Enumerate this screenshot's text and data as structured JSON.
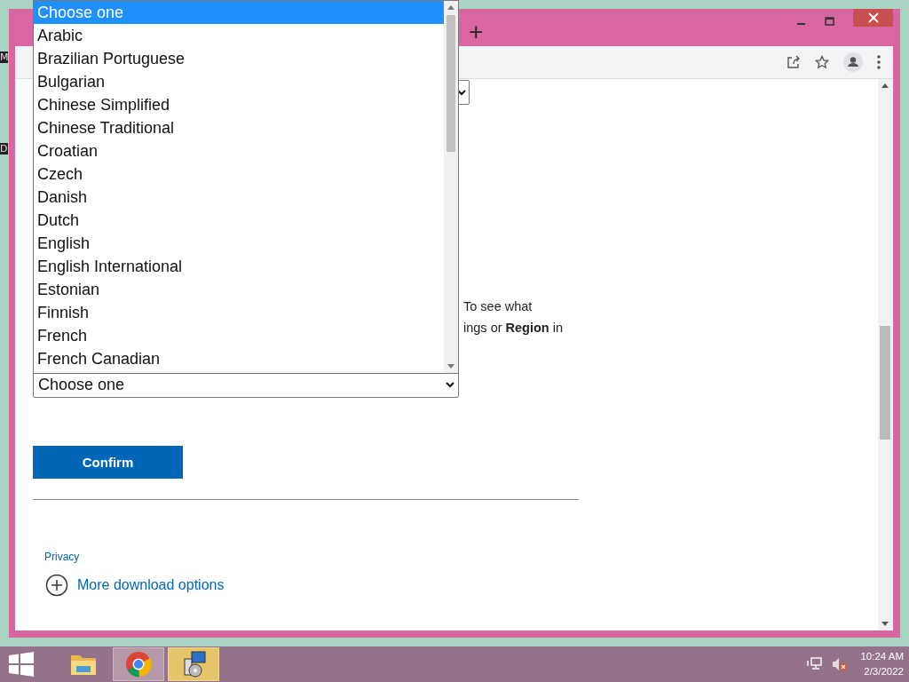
{
  "desktop": {
    "icon_labels": [
      "M",
      "D"
    ]
  },
  "browser": {
    "new_tab_label": "+"
  },
  "page": {
    "text_lines": [
      "To see what",
      "ings or **Region** in"
    ],
    "language_select": {
      "value": "Choose one"
    },
    "confirm_button": "Confirm",
    "privacy_link": "Privacy",
    "more_options_link": "More download options"
  },
  "language_list": {
    "options": [
      {
        "label": "Choose one",
        "selected": true
      },
      {
        "label": "Arabic",
        "selected": false
      },
      {
        "label": "Brazilian Portuguese",
        "selected": false
      },
      {
        "label": "Bulgarian",
        "selected": false
      },
      {
        "label": "Chinese Simplified",
        "selected": false
      },
      {
        "label": "Chinese Traditional",
        "selected": false
      },
      {
        "label": "Croatian",
        "selected": false
      },
      {
        "label": "Czech",
        "selected": false
      },
      {
        "label": "Danish",
        "selected": false
      },
      {
        "label": "Dutch",
        "selected": false
      },
      {
        "label": "English",
        "selected": false
      },
      {
        "label": "English International",
        "selected": false
      },
      {
        "label": "Estonian",
        "selected": false
      },
      {
        "label": "Finnish",
        "selected": false
      },
      {
        "label": "French",
        "selected": false
      },
      {
        "label": "French Canadian",
        "selected": false
      }
    ]
  },
  "taskbar": {
    "apps": [
      {
        "kind": "explorer",
        "open": false,
        "flashing": false
      },
      {
        "kind": "chrome",
        "open": true,
        "flashing": false
      },
      {
        "kind": "installer",
        "open": false,
        "flashing": true
      }
    ],
    "clock": {
      "time": "10:24 AM",
      "date": "2/3/2022"
    }
  }
}
